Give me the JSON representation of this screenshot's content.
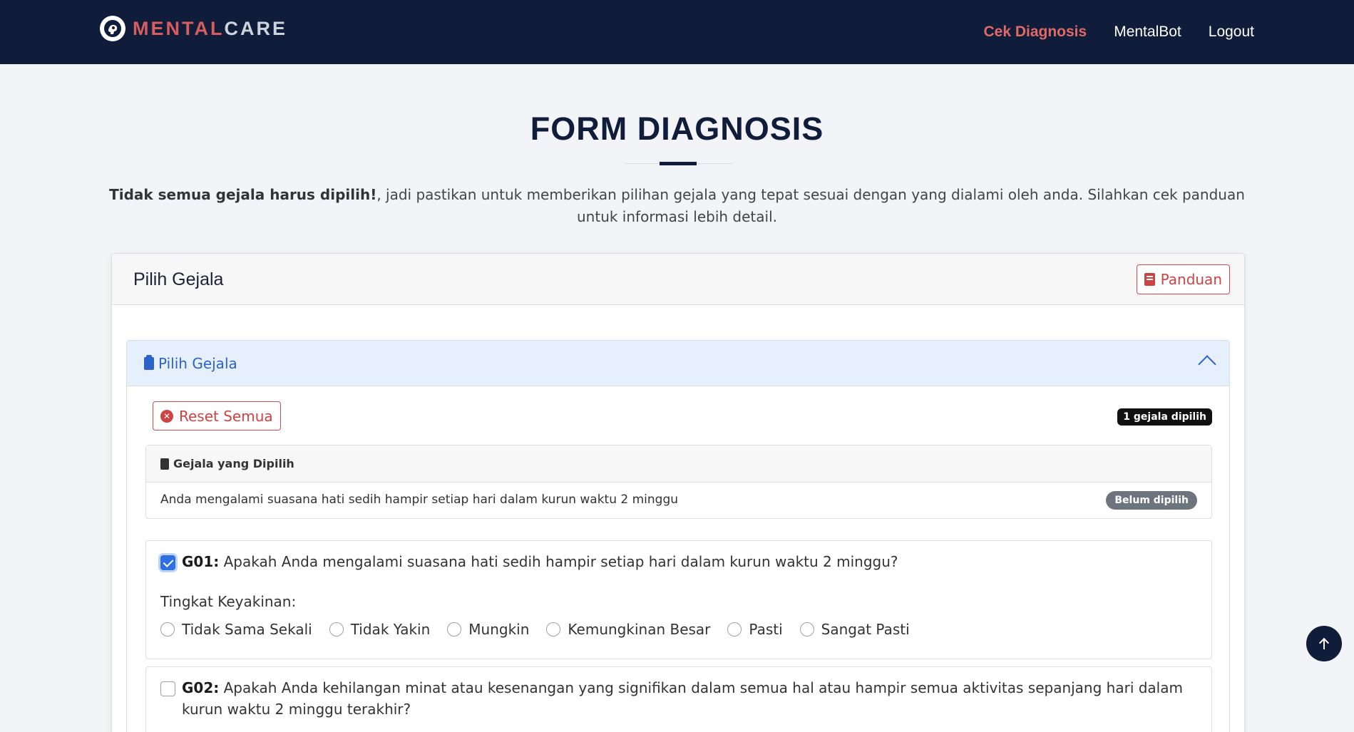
{
  "navbar": {
    "brand_part1": "MENTAL",
    "brand_part2": "CARE",
    "links": [
      "Cek Diagnosis",
      "MentalBot",
      "Logout"
    ]
  },
  "page": {
    "title": "FORM DIAGNOSIS",
    "intro_bold": "Tidak semua gejala harus dipilih!",
    "intro_rest": ", jadi pastikan untuk memberikan pilihan gejala yang tepat sesuai dengan yang dialami oleh anda. Silahkan cek panduan untuk informasi lebih detail."
  },
  "card": {
    "title": "Pilih Gejala",
    "guide_button": "Panduan"
  },
  "accordion": {
    "title": "Pilih Gejala",
    "reset_button": "Reset Semua",
    "count_badge": "1 gejala dipilih",
    "selected_title": "Gejala yang Dipilih",
    "selected_item": "Anda mengalami suasana hati sedih hampir setiap hari dalam kurun waktu 2 minggu",
    "selected_status": "Belum dipilih"
  },
  "questions": [
    {
      "code": "G01:",
      "text": " Apakah Anda mengalami suasana hati sedih hampir setiap hari dalam kurun waktu 2 minggu?",
      "checked": true,
      "confidence_label": "Tingkat Keyakinan:",
      "options": [
        "Tidak Sama Sekali",
        "Tidak Yakin",
        "Mungkin",
        "Kemungkinan Besar",
        "Pasti",
        "Sangat Pasti"
      ]
    },
    {
      "code": "G02:",
      "text": " Apakah Anda kehilangan minat atau kesenangan yang signifikan dalam semua hal atau hampir semua aktivitas sepanjang hari dalam kurun waktu 2 minggu terakhir?",
      "checked": false
    }
  ],
  "colors": {
    "navy": "#0f1c3a",
    "accent_red": "#d65e5e",
    "link_blue": "#2f62c9"
  }
}
